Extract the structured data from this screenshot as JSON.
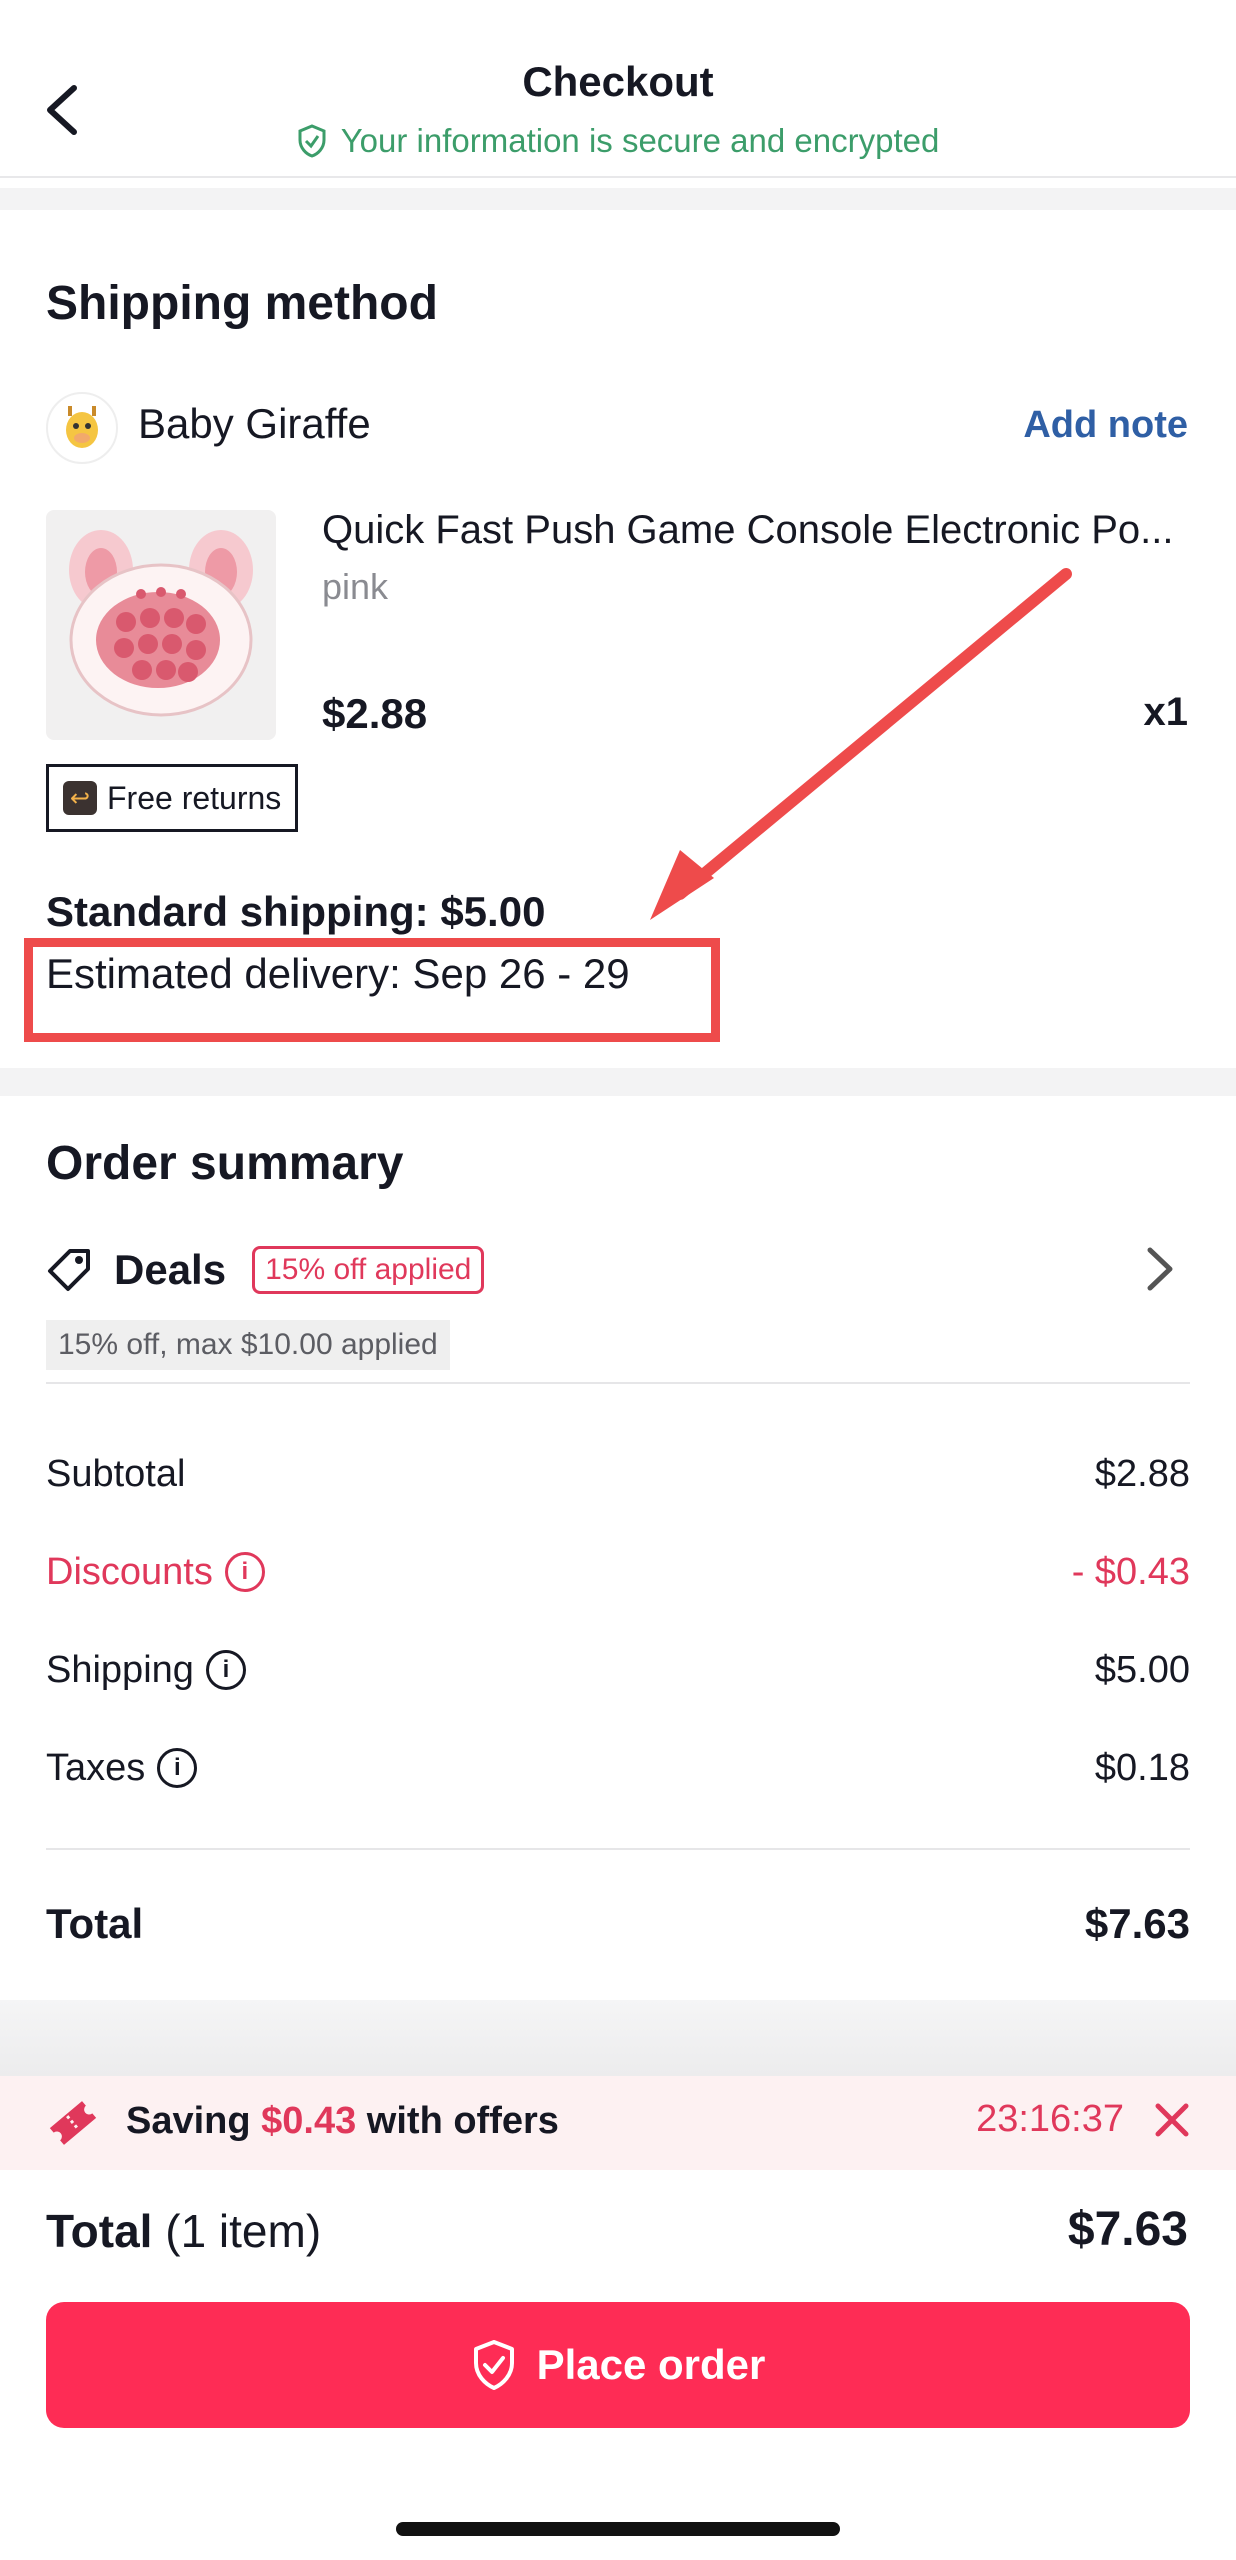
{
  "header": {
    "title": "Checkout",
    "subtitle": "Your information is secure and encrypted"
  },
  "shipping": {
    "section_title": "Shipping method",
    "store_name": "Baby Giraffe",
    "add_note_label": "Add note",
    "product": {
      "title": "Quick Fast Push Game Console Electronic Po...",
      "variant": "pink",
      "price": "$2.88",
      "quantity": "x1"
    },
    "free_returns_label": "Free returns",
    "standard_shipping": "Standard shipping: $5.00",
    "estimated_delivery": "Estimated delivery: Sep 26 - 29"
  },
  "order_summary": {
    "title": "Order summary",
    "deals_label": "Deals",
    "deals_badge": "15% off applied",
    "deals_note": "15% off, max $10.00 applied",
    "rows": [
      {
        "label": "Subtotal",
        "value": "$2.88"
      },
      {
        "label": "Discounts",
        "value": "- $0.43"
      },
      {
        "label": "Shipping",
        "value": "$5.00"
      },
      {
        "label": "Taxes",
        "value": "$0.18"
      }
    ],
    "total_label": "Total",
    "total_value": "$7.63"
  },
  "offer_bar": {
    "prefix": "Saving ",
    "amount": "$0.43",
    "suffix": " with offers",
    "timer": "23:16:37"
  },
  "footer": {
    "total_label": "Total",
    "item_count": "(1 item)",
    "total_value": "$7.63",
    "place_order_label": "Place order"
  },
  "colors": {
    "accent": "#fe2c55",
    "discount": "#e0385b",
    "secure_green": "#3c9d6a",
    "link_blue": "#2f5fa5",
    "highlight_red": "#ee4b4b"
  },
  "icons": [
    "back-chevron-icon",
    "shield-check-icon",
    "tag-icon",
    "chevron-right-icon",
    "info-icon",
    "ticket-icon",
    "close-icon",
    "return-icon"
  ]
}
